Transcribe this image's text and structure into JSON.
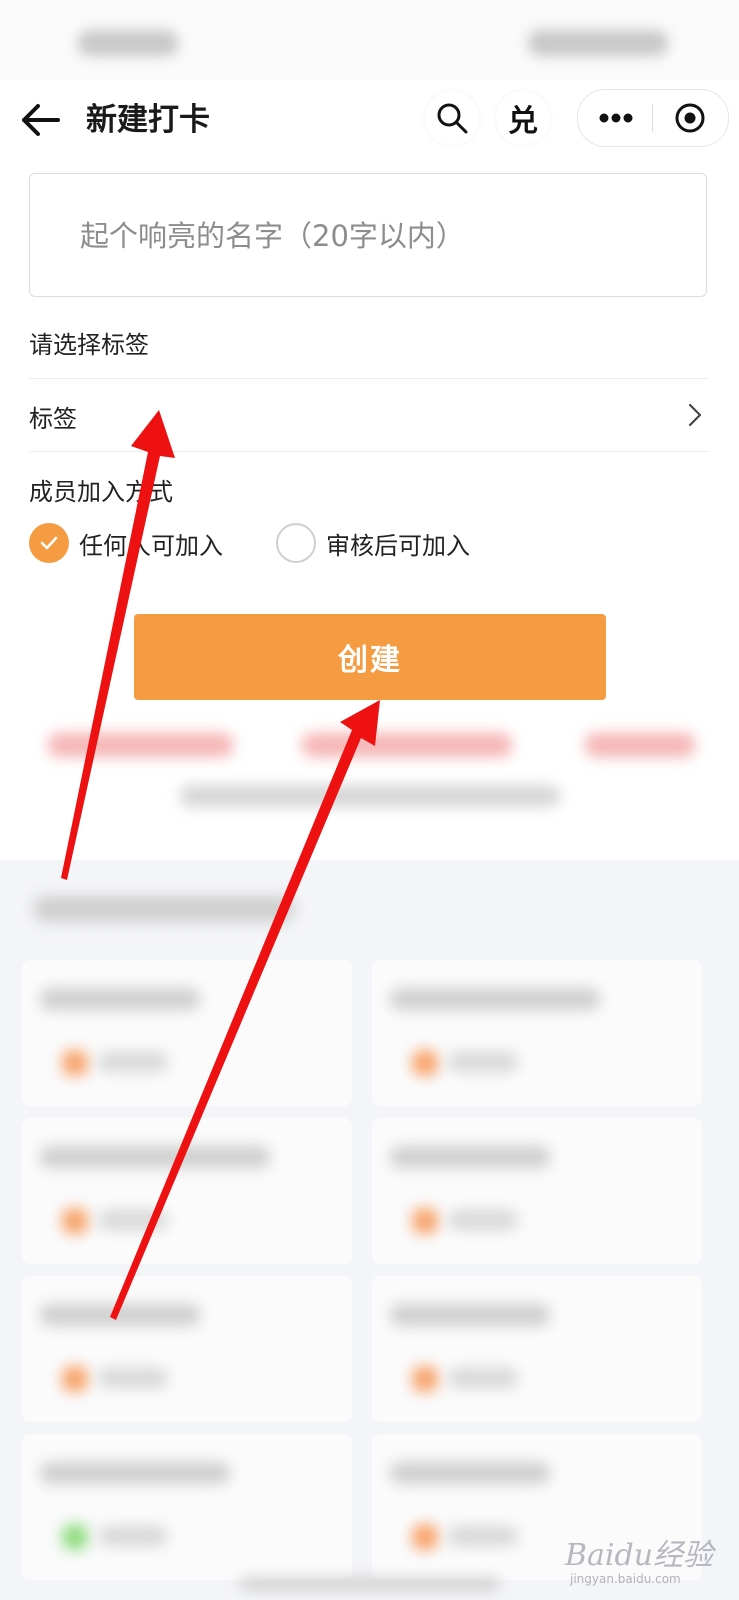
{
  "nav": {
    "title": "新建打卡",
    "exchange_label": "兑"
  },
  "form": {
    "name_placeholder": "起个响亮的名字（20字以内）",
    "tag_section_label": "请选择标签",
    "tag_row_label": "标签",
    "join_section_label": "成员加入方式",
    "join_options": [
      {
        "label": "任何人可加入",
        "selected": true
      },
      {
        "label": "审核后可加入",
        "selected": false
      }
    ],
    "create_label": "创建"
  },
  "watermark": {
    "brand": "Baidu经验",
    "site": "jingyan.baidu.com"
  },
  "colors": {
    "accent": "#f59b42",
    "annotation_arrow": "#ee1111"
  }
}
